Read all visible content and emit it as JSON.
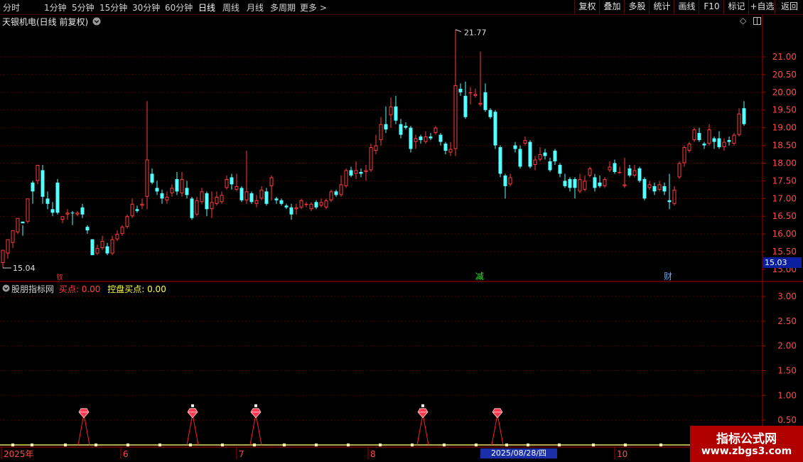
{
  "toolbar": {
    "periods": [
      "分时",
      "1分钟",
      "5分钟",
      "15分钟",
      "30分钟",
      "60分钟",
      "日线",
      "周线",
      "月线",
      "多周期",
      "更多 >"
    ],
    "active_period": "日线",
    "right_buttons": [
      "复权",
      "叠加",
      "多股",
      "统计",
      "画线",
      "F10",
      "标记",
      "+自选",
      "返回"
    ]
  },
  "stock": {
    "title": "天银机电(日线 前复权)"
  },
  "markers": {
    "high_label": "21.77",
    "low_label": "15.04",
    "current_price": "15.03",
    "event_tags": [
      {
        "text": "减",
        "color": "#33dd33"
      },
      {
        "text": "财",
        "color": "#66aaff"
      }
    ],
    "red_tag": "钗"
  },
  "indicator": {
    "name": "股朋指标网",
    "buy_label": "买点: 0.00",
    "control_label": "控盘买点: 0.00"
  },
  "price_axis": [
    "21.00",
    "20.50",
    "20.00",
    "19.50",
    "19.00",
    "18.50",
    "18.00",
    "17.50",
    "17.00",
    "16.50",
    "16.00",
    "15.50",
    "15.00"
  ],
  "indicator_axis": [
    "3.00",
    "2.50",
    "2.00",
    "1.50",
    "1.00",
    "0.50"
  ],
  "date_axis": [
    "2025年",
    "6",
    "7",
    "8",
    "10"
  ],
  "cursor_date": "2025/08/28/四",
  "watermark": {
    "title": "指标公式网",
    "url": "www.zbgs3.com"
  },
  "colors": {
    "up": "#ff3c3c",
    "down": "#54ffff",
    "grid": "#5a0000",
    "axis": "#b00000"
  },
  "chart_data": {
    "type": "candlestick",
    "y_range": [
      15.0,
      21.9
    ],
    "indicator_y_range": [
      0,
      3.2
    ],
    "candles": [
      [
        15.18,
        15.55,
        15.04,
        15.45
      ],
      [
        15.45,
        15.85,
        15.3,
        15.75
      ],
      [
        15.75,
        16.1,
        15.6,
        16.05
      ],
      [
        16.05,
        16.45,
        16.0,
        16.4
      ],
      [
        16.35,
        16.3,
        15.95,
        16.25
      ],
      [
        16.35,
        17.0,
        16.3,
        16.95
      ],
      [
        17.45,
        17.2,
        16.85,
        17.5
      ],
      [
        17.5,
        17.95,
        17.4,
        17.85
      ],
      [
        17.8,
        17.05,
        16.85,
        17.95
      ],
      [
        17.0,
        16.85,
        16.7,
        17.2
      ],
      [
        16.7,
        16.6,
        16.5,
        16.9
      ],
      [
        17.45,
        16.6,
        16.55,
        17.55
      ],
      [
        16.4,
        16.5,
        16.3,
        16.45
      ],
      [
        16.55,
        16.6,
        16.4,
        16.7
      ],
      [
        16.6,
        16.58,
        16.25,
        16.65
      ],
      [
        16.55,
        16.6,
        16.5,
        16.65
      ],
      [
        16.75,
        16.55,
        16.45,
        16.85
      ],
      [
        16.2,
        16.1,
        16.0,
        16.25
      ],
      [
        15.85,
        15.4,
        15.4,
        15.85
      ],
      [
        15.45,
        15.6,
        15.4,
        15.7
      ],
      [
        15.6,
        15.8,
        15.55,
        15.95
      ],
      [
        15.65,
        15.45,
        15.4,
        15.75
      ],
      [
        15.45,
        15.85,
        15.4,
        15.95
      ],
      [
        15.85,
        16.0,
        15.8,
        16.1
      ],
      [
        16.0,
        16.2,
        15.95,
        16.25
      ],
      [
        16.2,
        16.5,
        16.15,
        16.55
      ],
      [
        16.5,
        16.85,
        16.45,
        17.0
      ],
      [
        16.7,
        16.65,
        16.6,
        16.8
      ],
      [
        16.8,
        16.85,
        16.7,
        17.0
      ],
      [
        17.05,
        18.1,
        16.7,
        19.75
      ],
      [
        17.7,
        17.45,
        17.4,
        17.85
      ],
      [
        17.3,
        17.2,
        17.1,
        17.5
      ],
      [
        17.15,
        17.0,
        16.85,
        17.25
      ],
      [
        16.95,
        17.05,
        16.85,
        17.2
      ],
      [
        17.15,
        17.3,
        17.05,
        17.4
      ],
      [
        17.55,
        17.2,
        17.1,
        17.75
      ],
      [
        17.15,
        17.55,
        17.05,
        17.75
      ],
      [
        17.3,
        17.1,
        17.0,
        17.5
      ],
      [
        17.0,
        16.45,
        16.4,
        17.05
      ],
      [
        16.55,
        16.95,
        16.5,
        17.05
      ],
      [
        16.9,
        17.2,
        16.85,
        17.3
      ],
      [
        17.15,
        16.7,
        16.5,
        17.2
      ],
      [
        16.7,
        16.9,
        16.45,
        17.2
      ],
      [
        16.85,
        17.05,
        16.8,
        17.2
      ],
      [
        16.9,
        17.1,
        16.85,
        17.2
      ],
      [
        17.3,
        17.55,
        17.25,
        17.65
      ],
      [
        17.6,
        17.4,
        17.25,
        17.7
      ],
      [
        17.25,
        17.35,
        17.2,
        17.7
      ],
      [
        17.3,
        16.95,
        16.9,
        17.35
      ],
      [
        16.95,
        17.2,
        16.85,
        18.35
      ],
      [
        17.15,
        16.9,
        16.85,
        17.2
      ],
      [
        16.85,
        16.95,
        16.75,
        17.1
      ],
      [
        17.0,
        17.25,
        16.95,
        17.35
      ],
      [
        17.2,
        16.85,
        16.8,
        17.3
      ],
      [
        17.35,
        17.6,
        16.95,
        17.65
      ],
      [
        17.0,
        16.95,
        16.85,
        17.05
      ],
      [
        16.95,
        16.85,
        16.8,
        17.0
      ],
      [
        16.8,
        16.75,
        16.7,
        16.85
      ],
      [
        16.75,
        16.55,
        16.4,
        16.85
      ],
      [
        16.7,
        16.75,
        16.55,
        16.85
      ],
      [
        16.75,
        16.95,
        16.7,
        17.0
      ],
      [
        16.85,
        16.85,
        16.75,
        16.9
      ],
      [
        16.7,
        16.85,
        16.65,
        16.9
      ],
      [
        16.9,
        16.75,
        16.7,
        16.95
      ],
      [
        16.8,
        16.9,
        16.75,
        17.0
      ],
      [
        16.75,
        16.95,
        16.7,
        17.0
      ],
      [
        16.95,
        17.2,
        16.9,
        17.25
      ],
      [
        17.2,
        17.1,
        17.05,
        17.25
      ],
      [
        17.1,
        17.4,
        17.05,
        17.65
      ],
      [
        17.35,
        17.8,
        17.3,
        17.85
      ],
      [
        17.8,
        17.65,
        17.6,
        17.9
      ],
      [
        17.7,
        17.8,
        17.55,
        18.05
      ],
      [
        17.75,
        17.7,
        17.6,
        17.85
      ],
      [
        17.75,
        17.8,
        17.5,
        17.95
      ],
      [
        17.8,
        18.45,
        17.75,
        18.55
      ],
      [
        18.35,
        18.5,
        18.25,
        18.8
      ],
      [
        18.65,
        19.1,
        18.5,
        19.3
      ],
      [
        19.1,
        18.95,
        18.85,
        19.6
      ],
      [
        19.35,
        19.6,
        19.0,
        19.85
      ],
      [
        19.6,
        19.2,
        19.1,
        19.9
      ],
      [
        19.1,
        18.8,
        18.7,
        19.25
      ],
      [
        19.05,
        19.0,
        18.95,
        19.15
      ],
      [
        19.0,
        18.4,
        18.3,
        19.05
      ],
      [
        18.6,
        18.7,
        18.4,
        18.8
      ],
      [
        18.75,
        18.65,
        18.55,
        18.8
      ],
      [
        18.6,
        18.75,
        18.55,
        18.9
      ],
      [
        18.75,
        18.7,
        18.65,
        18.85
      ],
      [
        18.85,
        19.0,
        18.8,
        19.05
      ],
      [
        18.8,
        18.6,
        18.5,
        18.85
      ],
      [
        18.55,
        18.35,
        18.25,
        18.6
      ],
      [
        18.3,
        18.4,
        18.2,
        18.6
      ],
      [
        18.4,
        20.2,
        18.2,
        21.77
      ],
      [
        20.1,
        20.0,
        19.9,
        20.25
      ],
      [
        19.9,
        19.3,
        19.25,
        20.3
      ],
      [
        20.0,
        20.0,
        19.65,
        20.15
      ],
      [
        19.9,
        19.95,
        19.85,
        20.1
      ],
      [
        19.65,
        19.7,
        19.6,
        21.15
      ],
      [
        20.0,
        19.5,
        19.45,
        20.25
      ],
      [
        19.5,
        19.3,
        19.25,
        19.55
      ],
      [
        19.45,
        18.5,
        18.4,
        19.5
      ],
      [
        18.45,
        17.7,
        17.6,
        18.5
      ],
      [
        17.65,
        17.35,
        17.0,
        17.7
      ],
      [
        17.4,
        17.6,
        17.35,
        17.7
      ],
      [
        18.5,
        18.4,
        18.3,
        18.6
      ],
      [
        18.4,
        17.9,
        17.85,
        18.5
      ],
      [
        18.55,
        18.65,
        18.5,
        18.75
      ],
      [
        18.6,
        17.9,
        17.85,
        18.65
      ],
      [
        17.95,
        18.1,
        17.8,
        18.2
      ],
      [
        18.1,
        18.25,
        18.05,
        18.45
      ],
      [
        18.3,
        18.2,
        18.1,
        18.4
      ],
      [
        18.05,
        17.8,
        17.75,
        18.15
      ],
      [
        18.35,
        18.05,
        17.95,
        18.4
      ],
      [
        17.95,
        17.7,
        17.6,
        18.0
      ],
      [
        17.5,
        17.35,
        17.3,
        17.7
      ],
      [
        17.55,
        17.3,
        17.2,
        17.6
      ],
      [
        17.55,
        17.3,
        17.0,
        17.6
      ],
      [
        17.2,
        17.55,
        17.15,
        17.7
      ],
      [
        17.25,
        17.5,
        17.2,
        17.65
      ],
      [
        17.65,
        17.85,
        17.6,
        17.9
      ],
      [
        17.6,
        17.3,
        17.2,
        17.7
      ],
      [
        17.45,
        17.35,
        17.3,
        17.65
      ],
      [
        17.35,
        17.55,
        17.3,
        17.6
      ],
      [
        17.8,
        17.9,
        17.75,
        18.05
      ],
      [
        18.0,
        17.75,
        17.7,
        18.1
      ],
      [
        17.75,
        17.75,
        17.7,
        17.9
      ],
      [
        17.35,
        17.4,
        17.3,
        18.15
      ],
      [
        17.85,
        17.65,
        17.6,
        17.95
      ],
      [
        17.65,
        17.8,
        17.6,
        17.95
      ],
      [
        17.85,
        17.5,
        17.45,
        17.9
      ],
      [
        17.55,
        17.0,
        16.95,
        17.6
      ],
      [
        17.3,
        17.4,
        17.25,
        17.5
      ],
      [
        17.35,
        17.2,
        17.1,
        17.45
      ],
      [
        17.25,
        17.4,
        17.2,
        17.5
      ],
      [
        17.35,
        17.2,
        17.1,
        17.45
      ],
      [
        16.95,
        16.9,
        16.7,
        17.7
      ],
      [
        16.85,
        17.25,
        16.8,
        17.35
      ],
      [
        17.6,
        18.0,
        17.55,
        18.05
      ],
      [
        18.0,
        18.45,
        17.9,
        18.5
      ],
      [
        18.35,
        18.55,
        18.3,
        18.6
      ],
      [
        18.65,
        18.95,
        18.6,
        19.0
      ],
      [
        18.85,
        18.65,
        18.6,
        19.0
      ],
      [
        18.55,
        18.5,
        18.4,
        18.6
      ],
      [
        18.55,
        18.95,
        18.5,
        19.1
      ],
      [
        18.7,
        18.6,
        18.4,
        18.75
      ],
      [
        18.7,
        18.45,
        18.4,
        18.9
      ],
      [
        18.45,
        18.6,
        18.35,
        18.7
      ],
      [
        18.65,
        18.6,
        18.5,
        18.75
      ],
      [
        18.55,
        18.8,
        18.5,
        18.85
      ],
      [
        18.8,
        19.4,
        18.75,
        19.55
      ],
      [
        19.55,
        19.1,
        19.05,
        19.75
      ]
    ],
    "buy_signals": [
      0.62,
      0.62,
      0.62,
      0.62,
      0.62
    ]
  }
}
